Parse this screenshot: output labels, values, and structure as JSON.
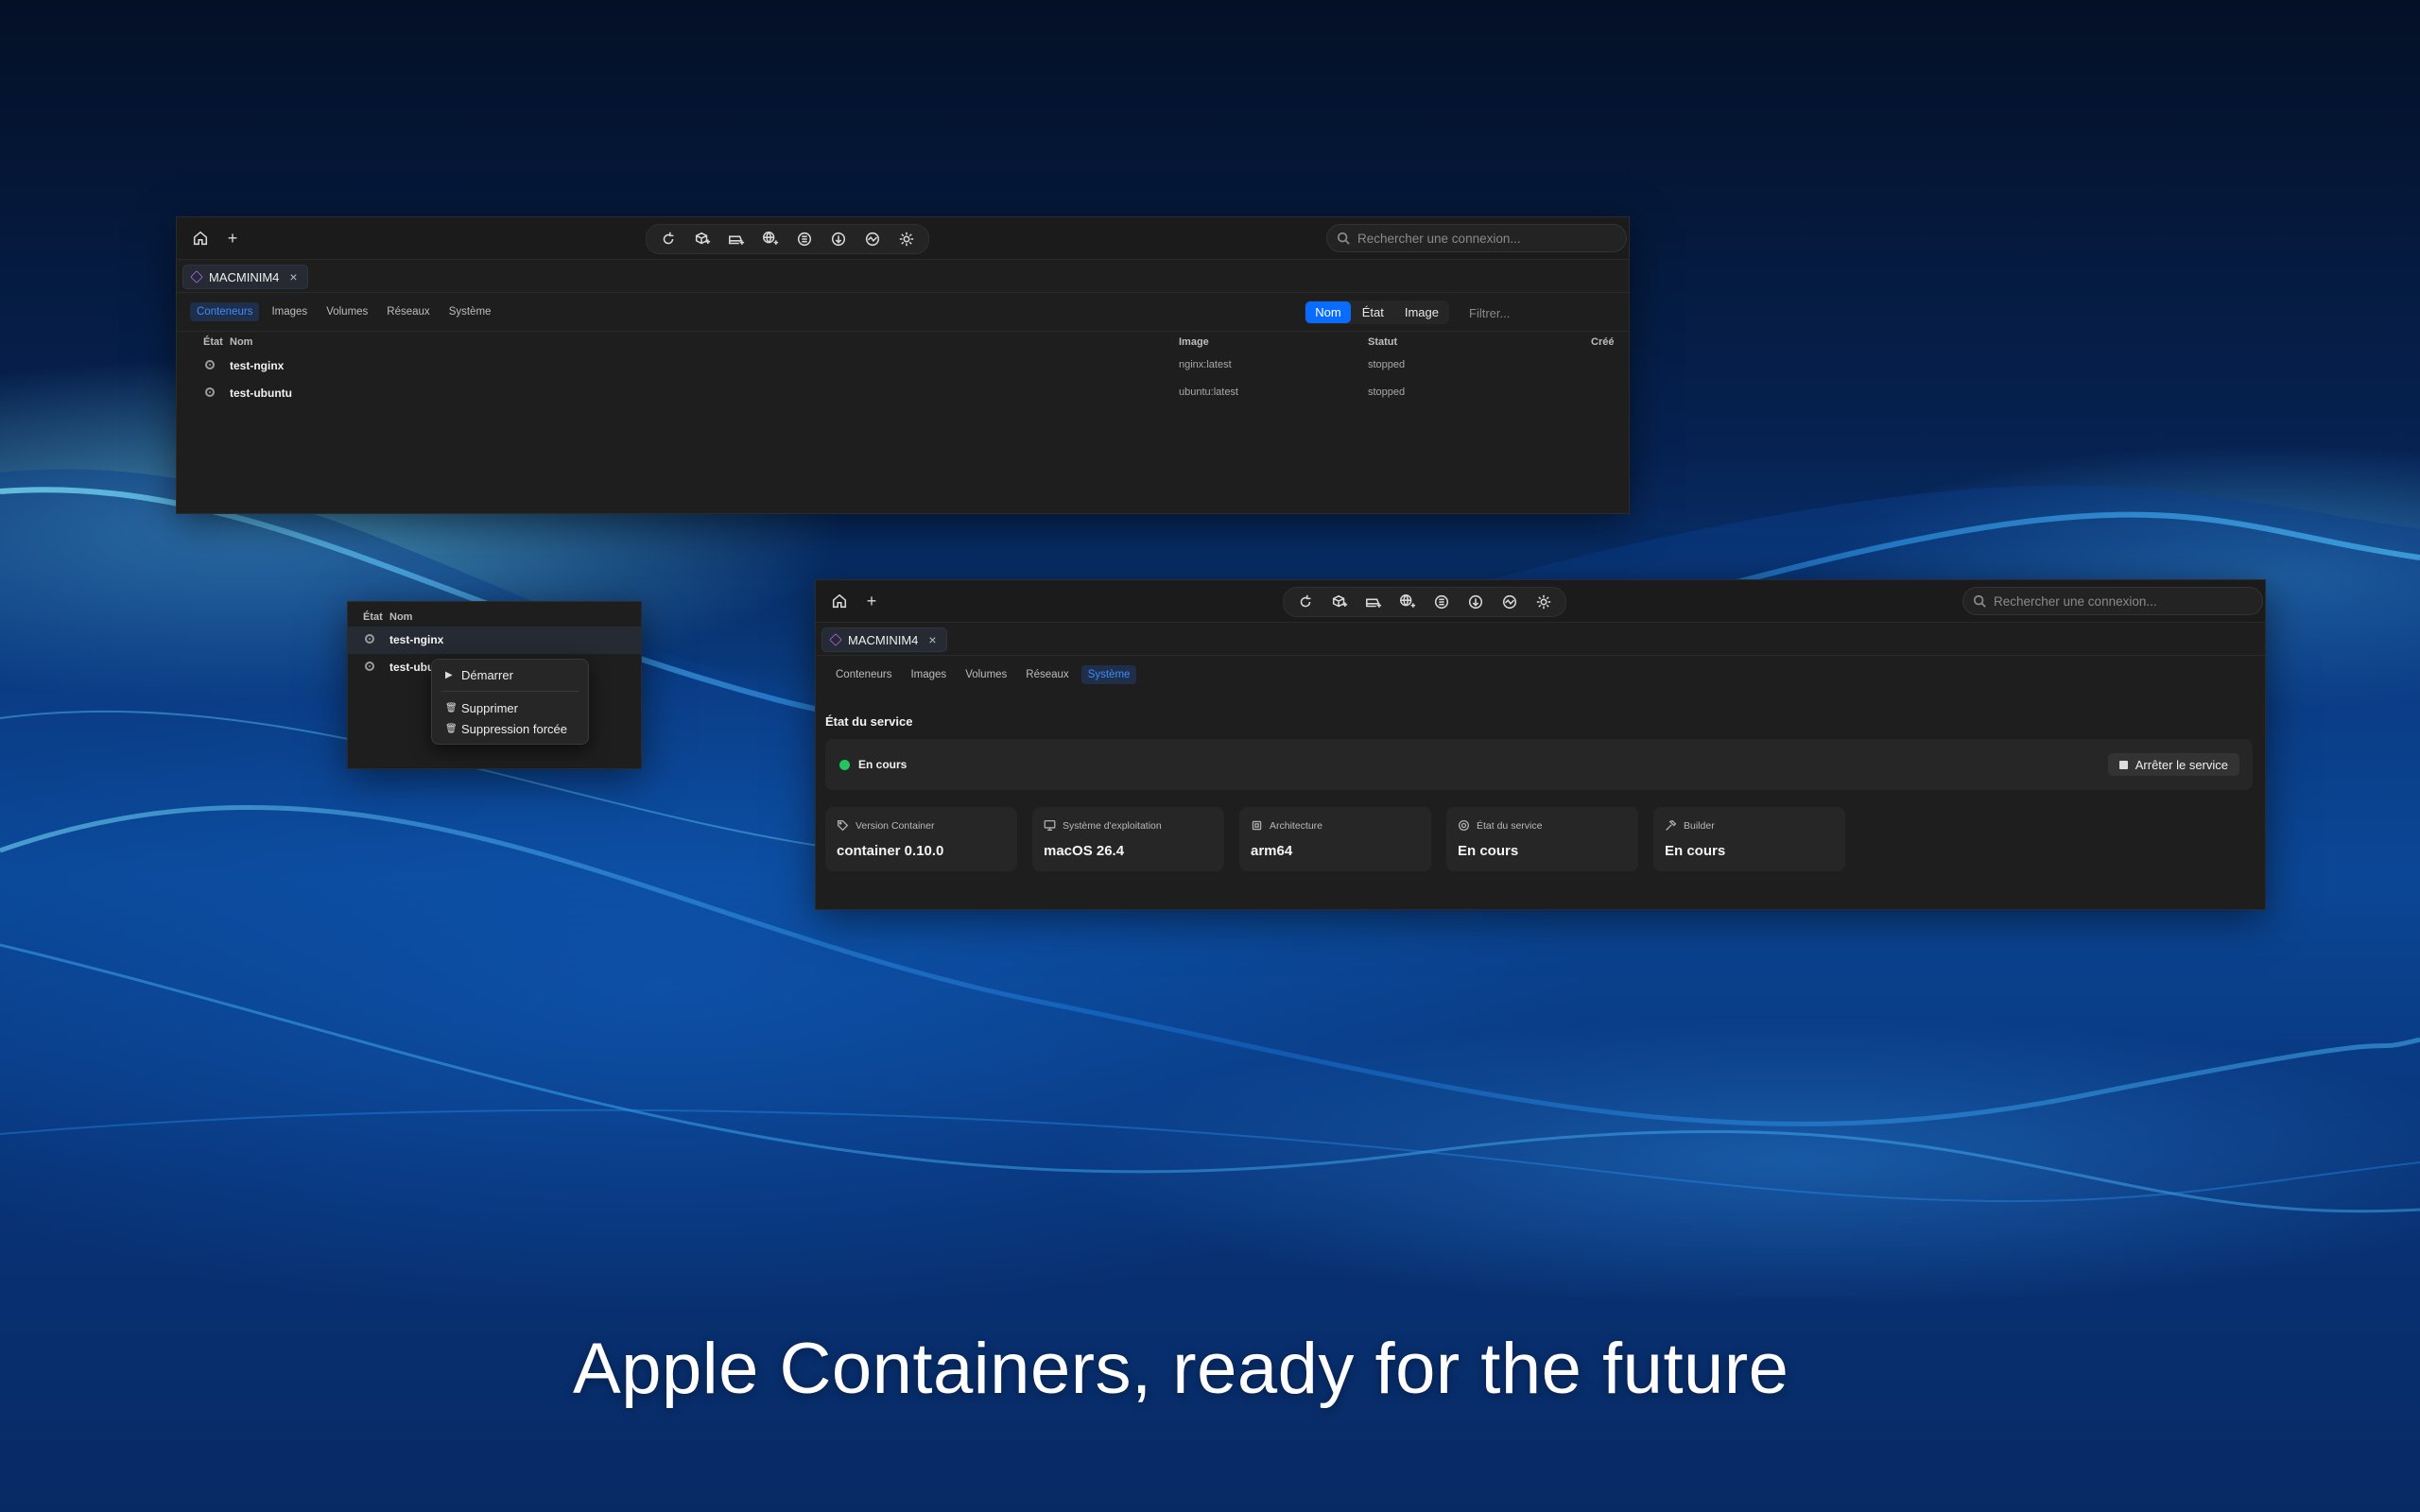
{
  "tagline": "Apple Containers, ready for the future",
  "search_placeholder": "Rechercher une connexion...",
  "connection_tab": "MACMINIM4",
  "close_glyph": "×",
  "plus_glyph": "+",
  "subtabs": [
    "Conteneurs",
    "Images",
    "Volumes",
    "Réseaux",
    "Système"
  ],
  "window1": {
    "segmented": [
      "Nom",
      "État",
      "Image"
    ],
    "filter_placeholder": "Filtrer...",
    "columns": {
      "state": "État",
      "name": "Nom",
      "image": "Image",
      "status": "Statut",
      "created": "Créé"
    },
    "rows": [
      {
        "name": "test-nginx",
        "image": "nginx:latest",
        "status": "stopped"
      },
      {
        "name": "test-ubuntu",
        "image": "ubuntu:latest",
        "status": "stopped"
      }
    ]
  },
  "window2": {
    "columns": {
      "state": "État",
      "name": "Nom"
    },
    "rows": [
      {
        "name": "test-nginx"
      },
      {
        "name": "test-ubu"
      }
    ],
    "menu": {
      "start": "Démarrer",
      "delete": "Supprimer",
      "force_delete": "Suppression forcée"
    }
  },
  "window3": {
    "section_title": "État du service",
    "status": "En cours",
    "status_color": "#22c55e",
    "stop_button": "Arrêter le service",
    "cards": [
      {
        "label": "Version Container",
        "value": "container 0.10.0",
        "icon": "tag-icon"
      },
      {
        "label": "Système d'exploitation",
        "value": "macOS 26.4",
        "icon": "monitor-icon"
      },
      {
        "label": "Architecture",
        "value": "arm64",
        "icon": "chip-icon"
      },
      {
        "label": "État du service",
        "value": "En cours",
        "icon": "gear-icon"
      },
      {
        "label": "Builder",
        "value": "En cours",
        "icon": "hammer-icon"
      }
    ]
  },
  "colors": {
    "accent": "#0a6cff",
    "active_tab": "#3d8bff",
    "running": "#22c55e"
  }
}
